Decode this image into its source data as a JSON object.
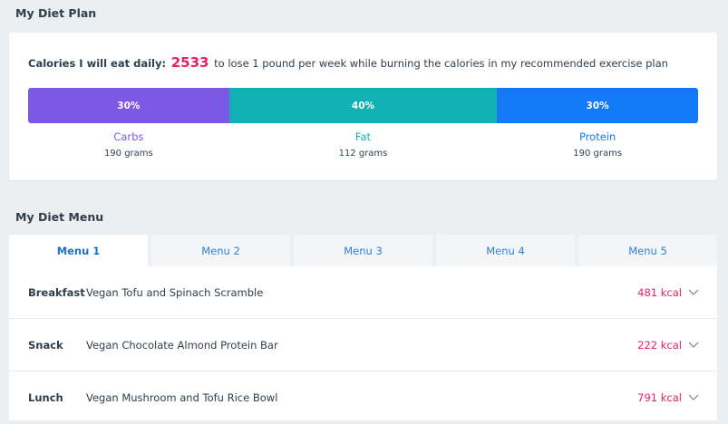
{
  "plan": {
    "title": "My Diet Plan",
    "calories_label": "Calories I will eat daily:",
    "calories_value": "2533",
    "calories_suffix": "to lose 1 pound per week while burning the calories in my recommended exercise plan",
    "macros": [
      {
        "name": "Carbs",
        "percent_label": "30%",
        "fraction": 0.3,
        "grams": "190 grams",
        "color": "#7b59e6"
      },
      {
        "name": "Fat",
        "percent_label": "40%",
        "fraction": 0.4,
        "grams": "112 grams",
        "color": "#12b0b5"
      },
      {
        "name": "Protein",
        "percent_label": "30%",
        "fraction": 0.3,
        "grams": "190 grams",
        "color": "#1479f6"
      }
    ]
  },
  "menu": {
    "title": "My Diet Menu",
    "tabs": [
      {
        "label": "Menu 1",
        "active": true
      },
      {
        "label": "Menu 2",
        "active": false
      },
      {
        "label": "Menu 3",
        "active": false
      },
      {
        "label": "Menu 4",
        "active": false
      },
      {
        "label": "Menu 5",
        "active": false
      }
    ],
    "meals": [
      {
        "type": "Breakfast",
        "name": "Vegan Tofu and Spinach Scramble",
        "kcal": "481 kcal"
      },
      {
        "type": "Snack",
        "name": "Vegan Chocolate Almond Protein Bar",
        "kcal": "222 kcal"
      },
      {
        "type": "Lunch",
        "name": "Vegan Mushroom and Tofu Rice Bowl",
        "kcal": "791 kcal"
      }
    ]
  },
  "colors": {
    "accent": "#e91e63",
    "tab_text": "#2f7fd8",
    "background": "#eceff1"
  },
  "icons": {
    "meal_expand": "chevron-down-icon"
  }
}
